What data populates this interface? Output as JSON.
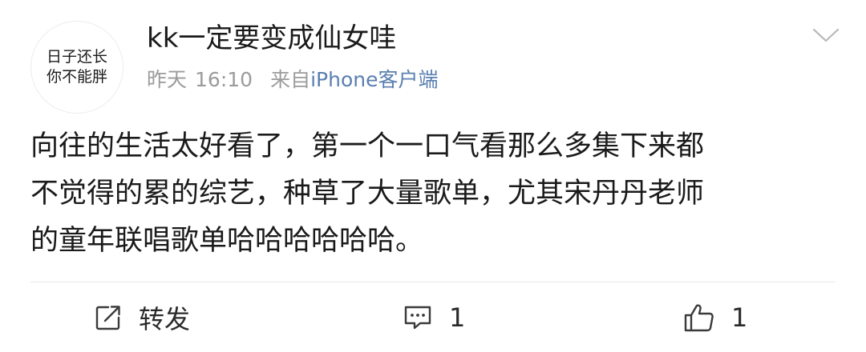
{
  "post": {
    "avatar": {
      "line1": "日子还长",
      "line2": "你不能胖"
    },
    "username": "kk一定要变成仙女哇",
    "date": "昨天",
    "time": "16:10",
    "source_prefix": "来自",
    "source_client": "iPhone客户端",
    "content_lines": [
      "向往的生活太好看了，第一个一口气看那么多集下来都",
      "不觉得的累的综艺，种草了大量歌单，尤其宋丹丹老师",
      "的童年联唱歌单哈哈哈哈哈哈。"
    ]
  },
  "actions": {
    "repost_label": "转发",
    "comment_count": "1",
    "like_count": "1"
  },
  "icons": {
    "menu": "chevron-down-icon",
    "repost": "repost-icon",
    "comment": "comment-icon",
    "like": "thumbs-up-icon"
  },
  "colors": {
    "text": "#1a1a1a",
    "meta": "#9b9b9b",
    "source_client": "#5a7fb0",
    "divider": "#e6e6e6"
  }
}
